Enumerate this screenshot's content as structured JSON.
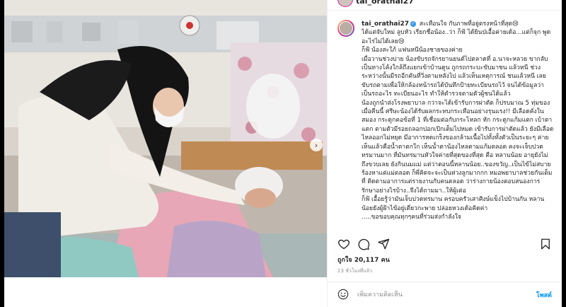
{
  "header": {
    "username": "tai_orathai27"
  },
  "caption": {
    "username": "tai_orathai27",
    "text": "สะเทือนใจ กับภาพที่อยู่ตรงหน้าที่สุด😢\nได้แต่จับใหม่ ลูบหัว เรียกชื่อน้อง..ว่า ก็ฟ้ ได้ยินป่เอื้อค่ายเด้อ...แต่ก็จุก พูดอะไรไม่ได้เลย😢\nก็ฟ้ น้องสะใภ้ แฟนหนีน้องชายของค่าย\nเมื่อวานช่วงบ่าย น้องขับรถจักรยานยนต์ไปตลาดที่ อ.นาจะหลวย ขากลับเป็นทางโค้งใกล้ถึงแยกเข้าบ้านดูน ถูกรถกระบะขับมาชน แล้วหนี ช่วงระหว่างนั้นมีรถอีกคันที่วิ่งตามหลังไป แล้วเห็นเหตุการณ์ ชนแล้วหนี เลยขับรถตามเพื่อให้กล้องหน้ารถได้บันทึกป้ายทะเบียนรถไว้ จนได้ข้อมูลว่าเป็นรถอะไร ทะเบียนอะไร ทำให้ตำรวจตามตัวผู้ชนได้แล้ว\nน้องถูกนำส่งโรงพยาบาล กว่าจะได้เข้ารับการผ่าตัด ก็ปรบมาณ 5 ทุ่มของเมื่อคืนนี้ ศรีษะน้องได้รับผลกระทบกระเทือนอย่างรุนแรง!! มีเลือดคั่งในสมอง กระดูกคอข้อที่ 1 ที่เชื่อมต่อกับกระโหลก หัก กระดูกแก้มแตก เบ้าตาแตก ตามตัวมีรอยถลอกปอกเปิกเต็มไปหมด เข้ารับการผ่าตัดแล้ว ยังมีเลือดไหลออกไม่หยุด มีอาการหดเกร็งของกล้ามเนื้อไปทั้งทั้งตัวเป็นระยะๆ ค่ายเห็นแล้วคือน้ำตาตกใก เห็นน้ำตาน้องไหลตามแก้มตลอด คงจะเจ็บปวดทรมานมาก ที่มันทรมานหัวใจค่ายที่สุดของที่สุด คือ หลานน้อย อายุยังไม่ถึงขวบเลย ยังกินนมแม่ แต่ว่าตอนนี้หลานน้อย..ของขวัญ..เป็นไข้ไม่สบายร้องหาแต่แม่ตลอด ก็พี่คิดจะจะเป็นห่วงลูกมากกก หมอพยาบาลช่วยกันเต็มที่ ติดตามอาการแต่รายงานกับคนตลอด ว่าร่างกายน้องตอบสนองการรักษาอย่างไรบ้าง..จึงได้ถามมา..ให้ผู้เต่อ\nก็ฟ้ เอื้อยรู้ว่ามันเจ็บปวดทรมาน ครอบครัวเสาศิงษ์แข็งไปบ้านกัน หลานน้อยยังผู้ฝ้าไข้อยู่เตี่ยวกะพาย ปล่อยหวงเด้อคิดค่า\n.....ขอขอบคุณทุกๆคนที่ร่วมส่งกำลังใจ"
  },
  "likes": {
    "text": "ถูกใจ 20,117 คน"
  },
  "timestamp": {
    "text": "23 ชั่วโมงที่แล้ว"
  },
  "comment": {
    "placeholder": "เพิ่มความคิดเห็น",
    "post_label": "โพสต์"
  },
  "icons": [
    "heart-icon",
    "comment-icon",
    "share-icon",
    "bookmark-icon",
    "emoji-icon",
    "chevron-right-icon"
  ],
  "colors": {
    "link": "#0095f6",
    "text": "#262626",
    "muted": "#8e8e8e",
    "verified": "#3897f0"
  }
}
